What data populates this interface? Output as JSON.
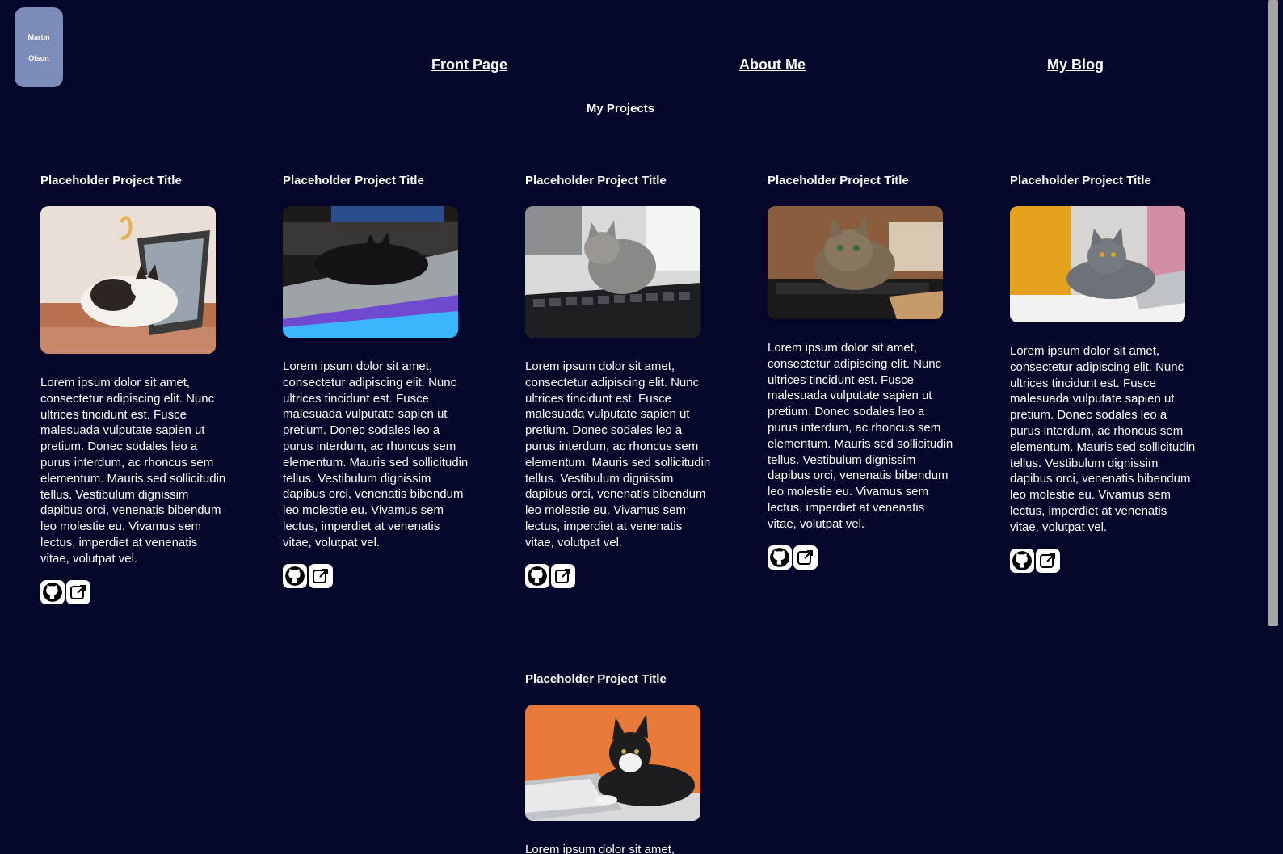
{
  "logo": {
    "first_name": "Martin",
    "last_name": "Olson"
  },
  "nav": {
    "front_page": "Front Page",
    "about_me": "About Me",
    "my_blog": "My Blog"
  },
  "section_title": "My Projects",
  "projects": [
    {
      "title": "Placeholder Project Title",
      "image": "cat-on-laptop-photo",
      "description": "Lorem ipsum dolor sit amet, consectetur adipiscing elit. Nunc ultrices tincidunt est. Fusce malesuada vulputate sapien ut pretium. Donec sodales leo a purus interdum, ac rhoncus sem elementum. Mauris sed sollicitudin tellus. Vestibulum dignissim dapibus orci, venenatis bibendum leo molestie eu. Vivamus sem lectus, imperdiet at venenatis vitae, volutpat vel.",
      "github_icon": "github-icon",
      "external_icon": "external-link-icon"
    },
    {
      "title": "Placeholder Project Title",
      "image": "cat-on-keyboard-photo",
      "description": "Lorem ipsum dolor sit amet, consectetur adipiscing elit. Nunc ultrices tincidunt est. Fusce malesuada vulputate sapien ut pretium. Donec sodales leo a purus interdum, ac rhoncus sem elementum. Mauris sed sollicitudin tellus. Vestibulum dignissim dapibus orci, venenatis bibendum leo molestie eu. Vivamus sem lectus, imperdiet at venenatis vitae, volutpat vel.",
      "github_icon": "github-icon",
      "external_icon": "external-link-icon"
    },
    {
      "title": "Placeholder Project Title",
      "image": "kitten-on-keyboard-photo",
      "description": "Lorem ipsum dolor sit amet, consectetur adipiscing elit. Nunc ultrices tincidunt est. Fusce malesuada vulputate sapien ut pretium. Donec sodales leo a purus interdum, ac rhoncus sem elementum. Mauris sed sollicitudin tellus. Vestibulum dignissim dapibus orci, venenatis bibendum leo molestie eu. Vivamus sem lectus, imperdiet at venenatis vitae, volutpat vel.",
      "github_icon": "github-icon",
      "external_icon": "external-link-icon"
    },
    {
      "title": "Placeholder Project Title",
      "image": "tabby-cat-keyboard-photo",
      "description": "Lorem ipsum dolor sit amet, consectetur adipiscing elit. Nunc ultrices tincidunt est. Fusce malesuada vulputate sapien ut pretium. Donec sodales leo a purus interdum, ac rhoncus sem elementum. Mauris sed sollicitudin tellus. Vestibulum dignissim dapibus orci, venenatis bibendum leo molestie eu. Vivamus sem lectus, imperdiet at venenatis vitae, volutpat vel.",
      "github_icon": "github-icon",
      "external_icon": "external-link-icon"
    },
    {
      "title": "Placeholder Project Title",
      "image": "gray-cat-laptop-photo",
      "description": "Lorem ipsum dolor sit amet, consectetur adipiscing elit. Nunc ultrices tincidunt est. Fusce malesuada vulputate sapien ut pretium. Donec sodales leo a purus interdum, ac rhoncus sem elementum. Mauris sed sollicitudin tellus. Vestibulum dignissim dapibus orci, venenatis bibendum leo molestie eu. Vivamus sem lectus, imperdiet at venenatis vitae, volutpat vel.",
      "github_icon": "github-icon",
      "external_icon": "external-link-icon"
    },
    {
      "title": "Placeholder Project Title",
      "image": "tuxedo-cat-laptop-photo",
      "description": "Lorem ipsum dolor sit amet,",
      "github_icon": "github-icon",
      "external_icon": "external-link-icon"
    }
  ],
  "colors": {
    "background": "#04062a",
    "logo_bg": "#7b8cb8",
    "text": "#ffffff"
  }
}
